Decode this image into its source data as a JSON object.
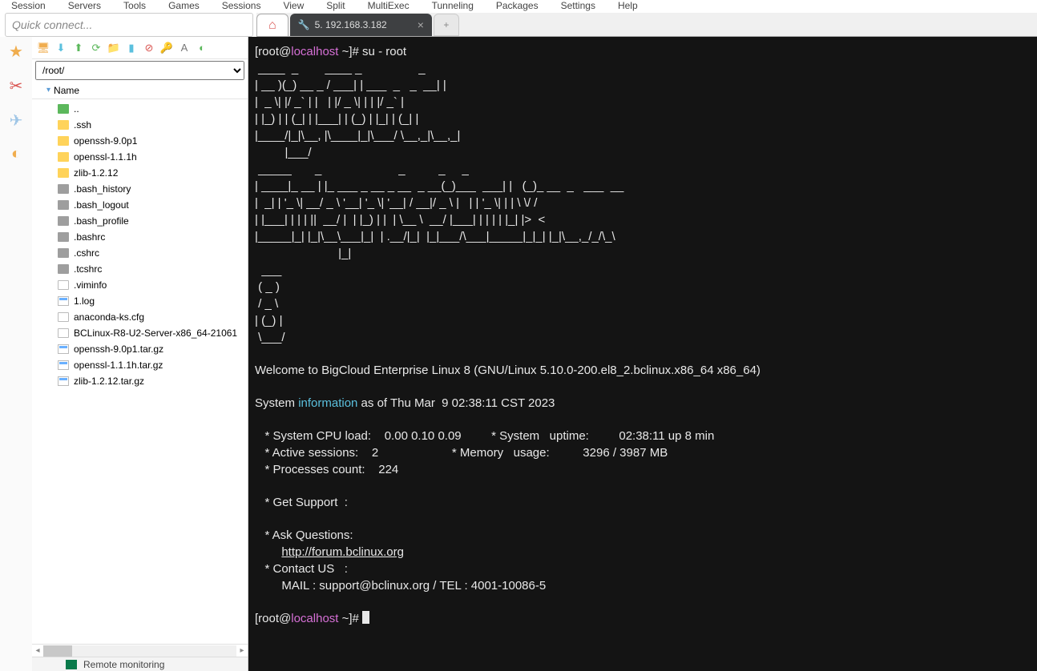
{
  "menubar": [
    "Session",
    "Servers",
    "Tools",
    "Games",
    "Sessions",
    "View",
    "Split",
    "MultiExec",
    "Tunneling",
    "Packages",
    "Settings",
    "Help"
  ],
  "quickconnect": {
    "placeholder": "Quick connect..."
  },
  "tabs": {
    "active_label": "5. 192.168.3.182",
    "add_label": "+"
  },
  "sidebar": {
    "path": "/root/",
    "name_header": "Name",
    "items": [
      {
        "icon": "folder-up",
        "label": ".."
      },
      {
        "icon": "folder",
        "label": ".ssh"
      },
      {
        "icon": "folder",
        "label": "openssh-9.0p1"
      },
      {
        "icon": "folder",
        "label": "openssl-1.1.1h"
      },
      {
        "icon": "folder",
        "label": "zlib-1.2.12"
      },
      {
        "icon": "file-gray",
        "label": ".bash_history"
      },
      {
        "icon": "file-gray",
        "label": ".bash_logout"
      },
      {
        "icon": "file-gray",
        "label": ".bash_profile"
      },
      {
        "icon": "file-gray",
        "label": ".bashrc"
      },
      {
        "icon": "file-gray",
        "label": ".cshrc"
      },
      {
        "icon": "file-gray",
        "label": ".tcshrc"
      },
      {
        "icon": "file-white",
        "label": ".viminfo"
      },
      {
        "icon": "file-blue",
        "label": "1.log"
      },
      {
        "icon": "file-white",
        "label": "anaconda-ks.cfg"
      },
      {
        "icon": "file-white",
        "label": "BCLinux-R8-U2-Server-x86_64-21061"
      },
      {
        "icon": "file-blue",
        "label": "openssh-9.0p1.tar.gz"
      },
      {
        "icon": "file-blue",
        "label": "openssl-1.1.1h.tar.gz"
      },
      {
        "icon": "file-blue",
        "label": "zlib-1.2.12.tar.gz"
      }
    ],
    "bottom_status": "Remote monitoring"
  },
  "terminal": {
    "user": "root",
    "host": "localhost",
    "cwd": "~",
    "cmd": "su - root",
    "ascii": [
      " ____  _        ____ _                 _",
      "| __ )(_) __ _ / ___| | ___  _   _  __| |",
      "|  _ \\| |/ _` | |   | |/ _ \\| | | |/ _` |",
      "| |_) | | (_| | |___| | (_) | |_| | (_| |",
      "|____/|_|\\__, |\\____|_|\\___/ \\__,_|\\__,_|",
      "         |___/",
      " _____       _                       _          _     _",
      "| ____|_ __ | |_ ___ _ __ _ __  _ __(_)___  ___| |   (_)_ __  _   ___  __",
      "|  _| | '_ \\| __/ _ \\ '__| '_ \\| '__| / __|/ _ \\ |   | | '_ \\| | | \\ \\/ /",
      "| |___| | | | ||  __/ |  | |_) | |  | \\__ \\  __/ |___| | | | | |_| |>  <",
      "|_____|_| |_|\\__\\___|_|  | .__/|_|  |_|___/\\___|_____|_|_| |_|\\__,_/_/\\_\\",
      "                         |_|",
      "  ___",
      " ( _ )",
      " / _ \\",
      "| (_) |",
      " \\___/"
    ],
    "welcome": "Welcome to BigCloud Enterprise Linux 8 (GNU/Linux 5.10.0-200.el8_2.bclinux.x86_64 x86_64)",
    "sysinfo_prefix": "System ",
    "sysinfo_word": "information",
    "sysinfo_suffix": " as of Thu Mar  9 02:38:11 CST 2023",
    "line_cpu": "   * System CPU load:    0.00 0.10 0.09         * System   uptime:         02:38:11 up 8 min",
    "line_sess": "   * Active sessions:    2                      * Memory   usage:          3296 / 3987 MB",
    "line_proc": "   * Processes count:    224",
    "line_support": "   * Get Support  :",
    "line_ask": "   * Ask Questions:",
    "forum_url": "http://forum.bclinux.org",
    "line_contact": "   * Contact US   :",
    "line_contact_detail": "        MAIL : support@bclinux.org / TEL : 4001-10086-5"
  }
}
